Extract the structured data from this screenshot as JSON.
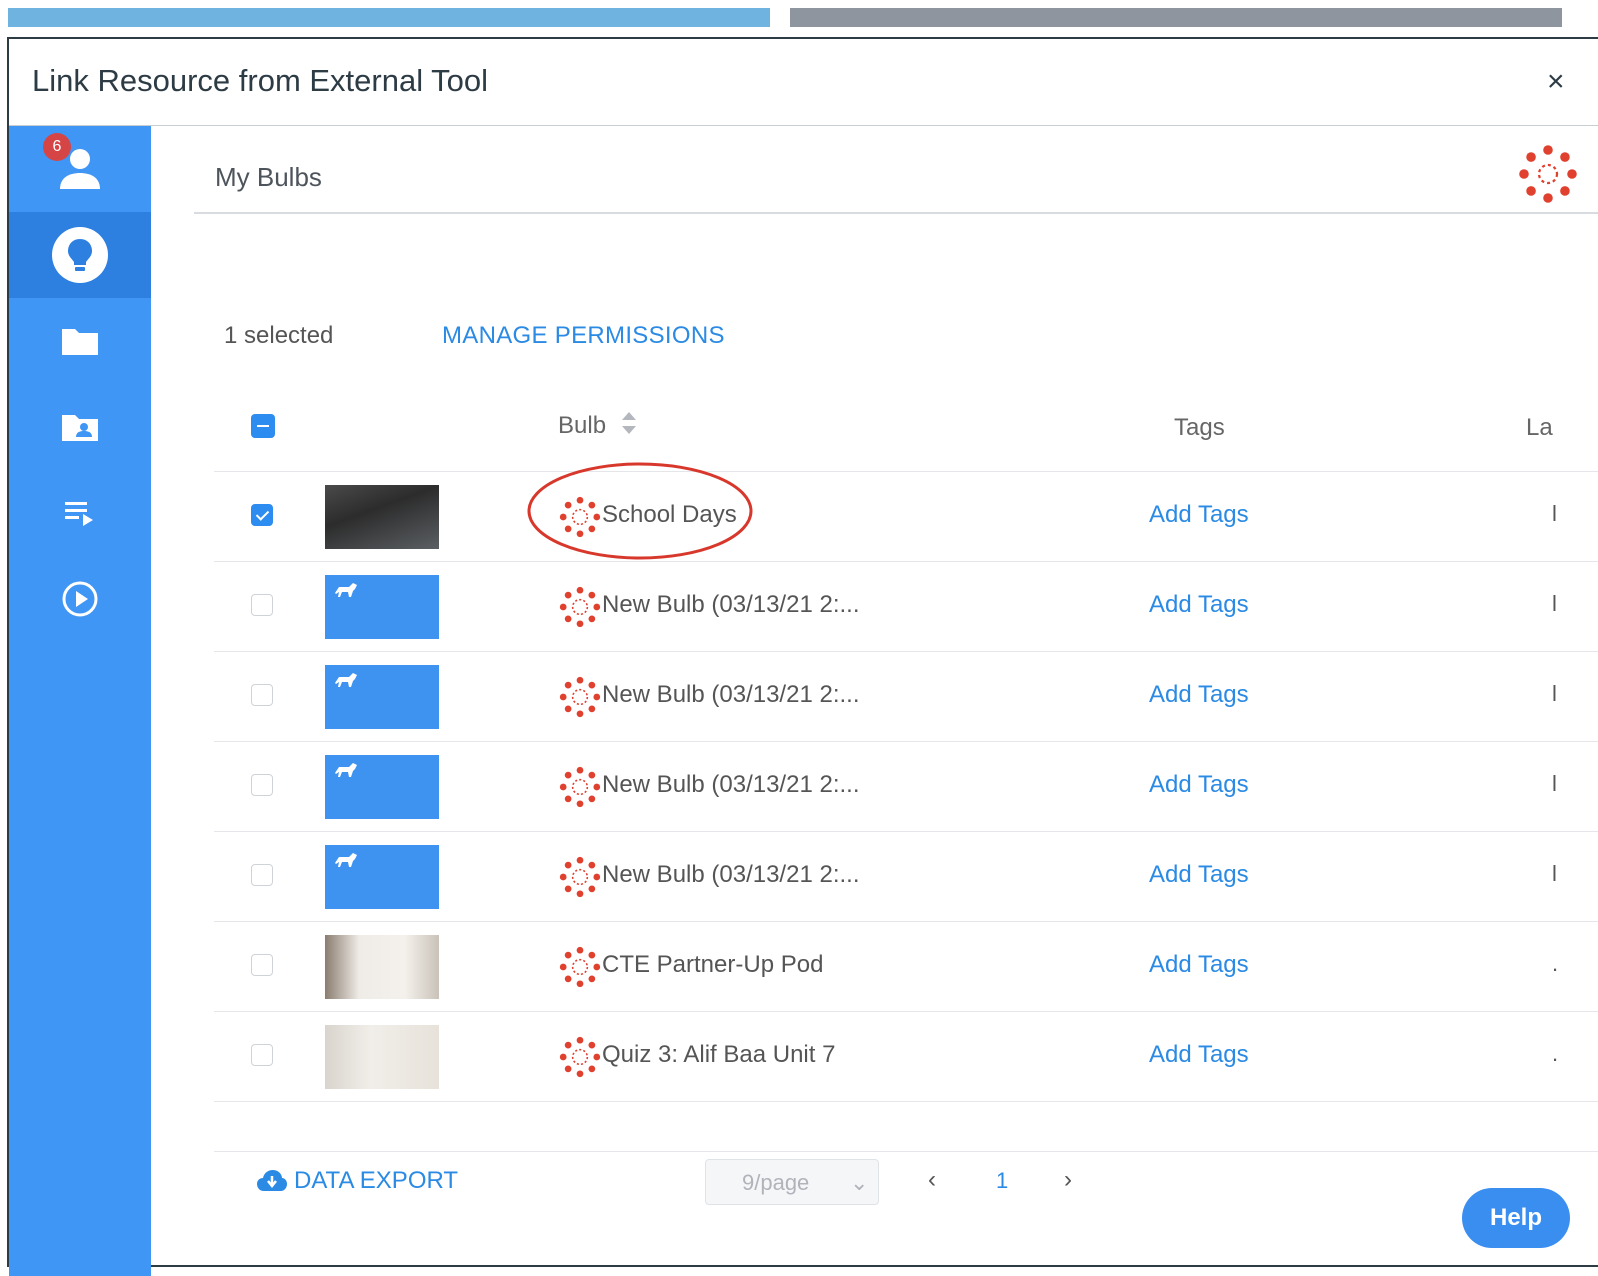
{
  "modal": {
    "title": "Link Resource from External Tool",
    "close_label": "×"
  },
  "sidebar": {
    "badge_count": "6",
    "items": [
      {
        "name": "profile"
      },
      {
        "name": "bulbs"
      },
      {
        "name": "folders"
      },
      {
        "name": "shared"
      },
      {
        "name": "playlists"
      },
      {
        "name": "player"
      }
    ]
  },
  "header": {
    "section_title": "My Bulbs"
  },
  "toolbar": {
    "selected_text": "1 selected",
    "manage_permissions": "MANAGE PERMISSIONS"
  },
  "table": {
    "columns": {
      "bulb": "Bulb",
      "tags": "Tags",
      "last": "La"
    },
    "rows": [
      {
        "name": "School Days",
        "tags": "Add Tags",
        "edge": "l",
        "checked": true,
        "thumb": "photo-a"
      },
      {
        "name": "New Bulb (03/13/21 2:...",
        "tags": "Add Tags",
        "edge": "l",
        "checked": false,
        "thumb": "blue"
      },
      {
        "name": "New Bulb (03/13/21 2:...",
        "tags": "Add Tags",
        "edge": "l",
        "checked": false,
        "thumb": "blue"
      },
      {
        "name": "New Bulb (03/13/21 2:...",
        "tags": "Add Tags",
        "edge": "l",
        "checked": false,
        "thumb": "blue"
      },
      {
        "name": "New Bulb (03/13/21 2:...",
        "tags": "Add Tags",
        "edge": "l",
        "checked": false,
        "thumb": "blue"
      },
      {
        "name": "CTE Partner-Up Pod",
        "tags": "Add Tags",
        "edge": ".",
        "checked": false,
        "thumb": "photo-b"
      },
      {
        "name": "Quiz 3: Alif Baa Unit 7",
        "tags": "Add Tags",
        "edge": ".",
        "checked": false,
        "thumb": "photo-c"
      }
    ]
  },
  "footer": {
    "data_export": "DATA EXPORT",
    "page_size": "9/page",
    "prev": "‹",
    "page": "1",
    "next": "›",
    "help": "Help"
  },
  "colors": {
    "accent": "#2a8ae4",
    "sidebar": "#4096f4",
    "canvas_red": "#e0412f",
    "annotation": "#d8382c"
  }
}
